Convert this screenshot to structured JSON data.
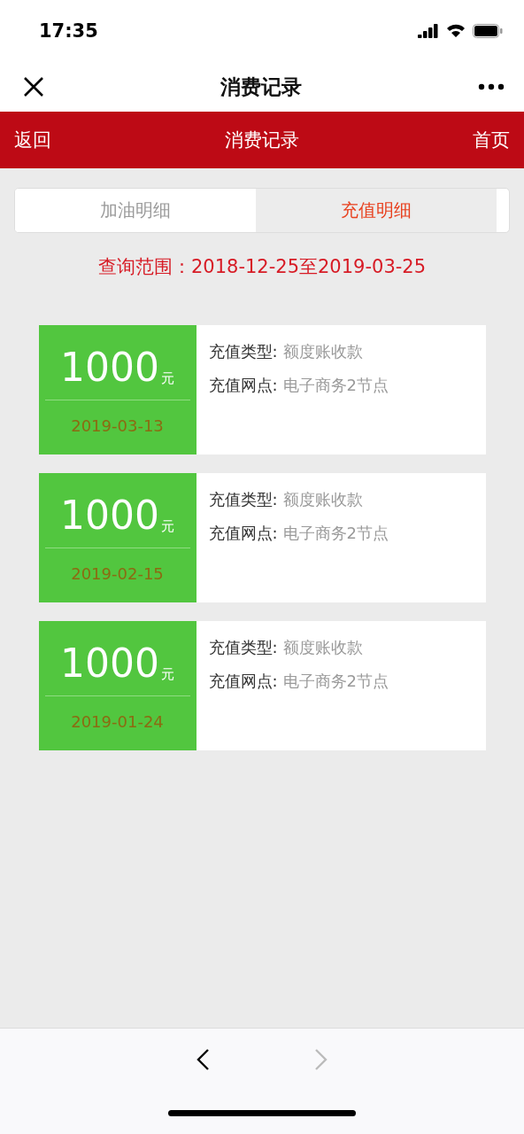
{
  "status_bar": {
    "time": "17:35"
  },
  "nav": {
    "title": "消费记录"
  },
  "header": {
    "back": "返回",
    "title": "消费记录",
    "home": "首页"
  },
  "tabs": [
    {
      "label": "加油明细",
      "selected": false
    },
    {
      "label": "充值明细",
      "selected": true
    }
  ],
  "query_range": "查询范围：2018-12-25至2019-03-25",
  "records": [
    {
      "amount": "1000",
      "unit": "元",
      "date": "2019-03-13",
      "fields": [
        {
          "label": "充值类型:",
          "value": "额度账收款"
        },
        {
          "label": "充值网点:",
          "value": "电子商务2节点"
        }
      ]
    },
    {
      "amount": "1000",
      "unit": "元",
      "date": "2019-02-15",
      "fields": [
        {
          "label": "充值类型:",
          "value": "额度账收款"
        },
        {
          "label": "充值网点:",
          "value": "电子商务2节点"
        }
      ]
    },
    {
      "amount": "1000",
      "unit": "元",
      "date": "2019-01-24",
      "fields": [
        {
          "label": "充值类型:",
          "value": "额度账收款"
        },
        {
          "label": "充值网点:",
          "value": "电子商务2节点"
        }
      ]
    }
  ],
  "toolbar": {
    "back_disabled": false,
    "forward_disabled": true
  }
}
